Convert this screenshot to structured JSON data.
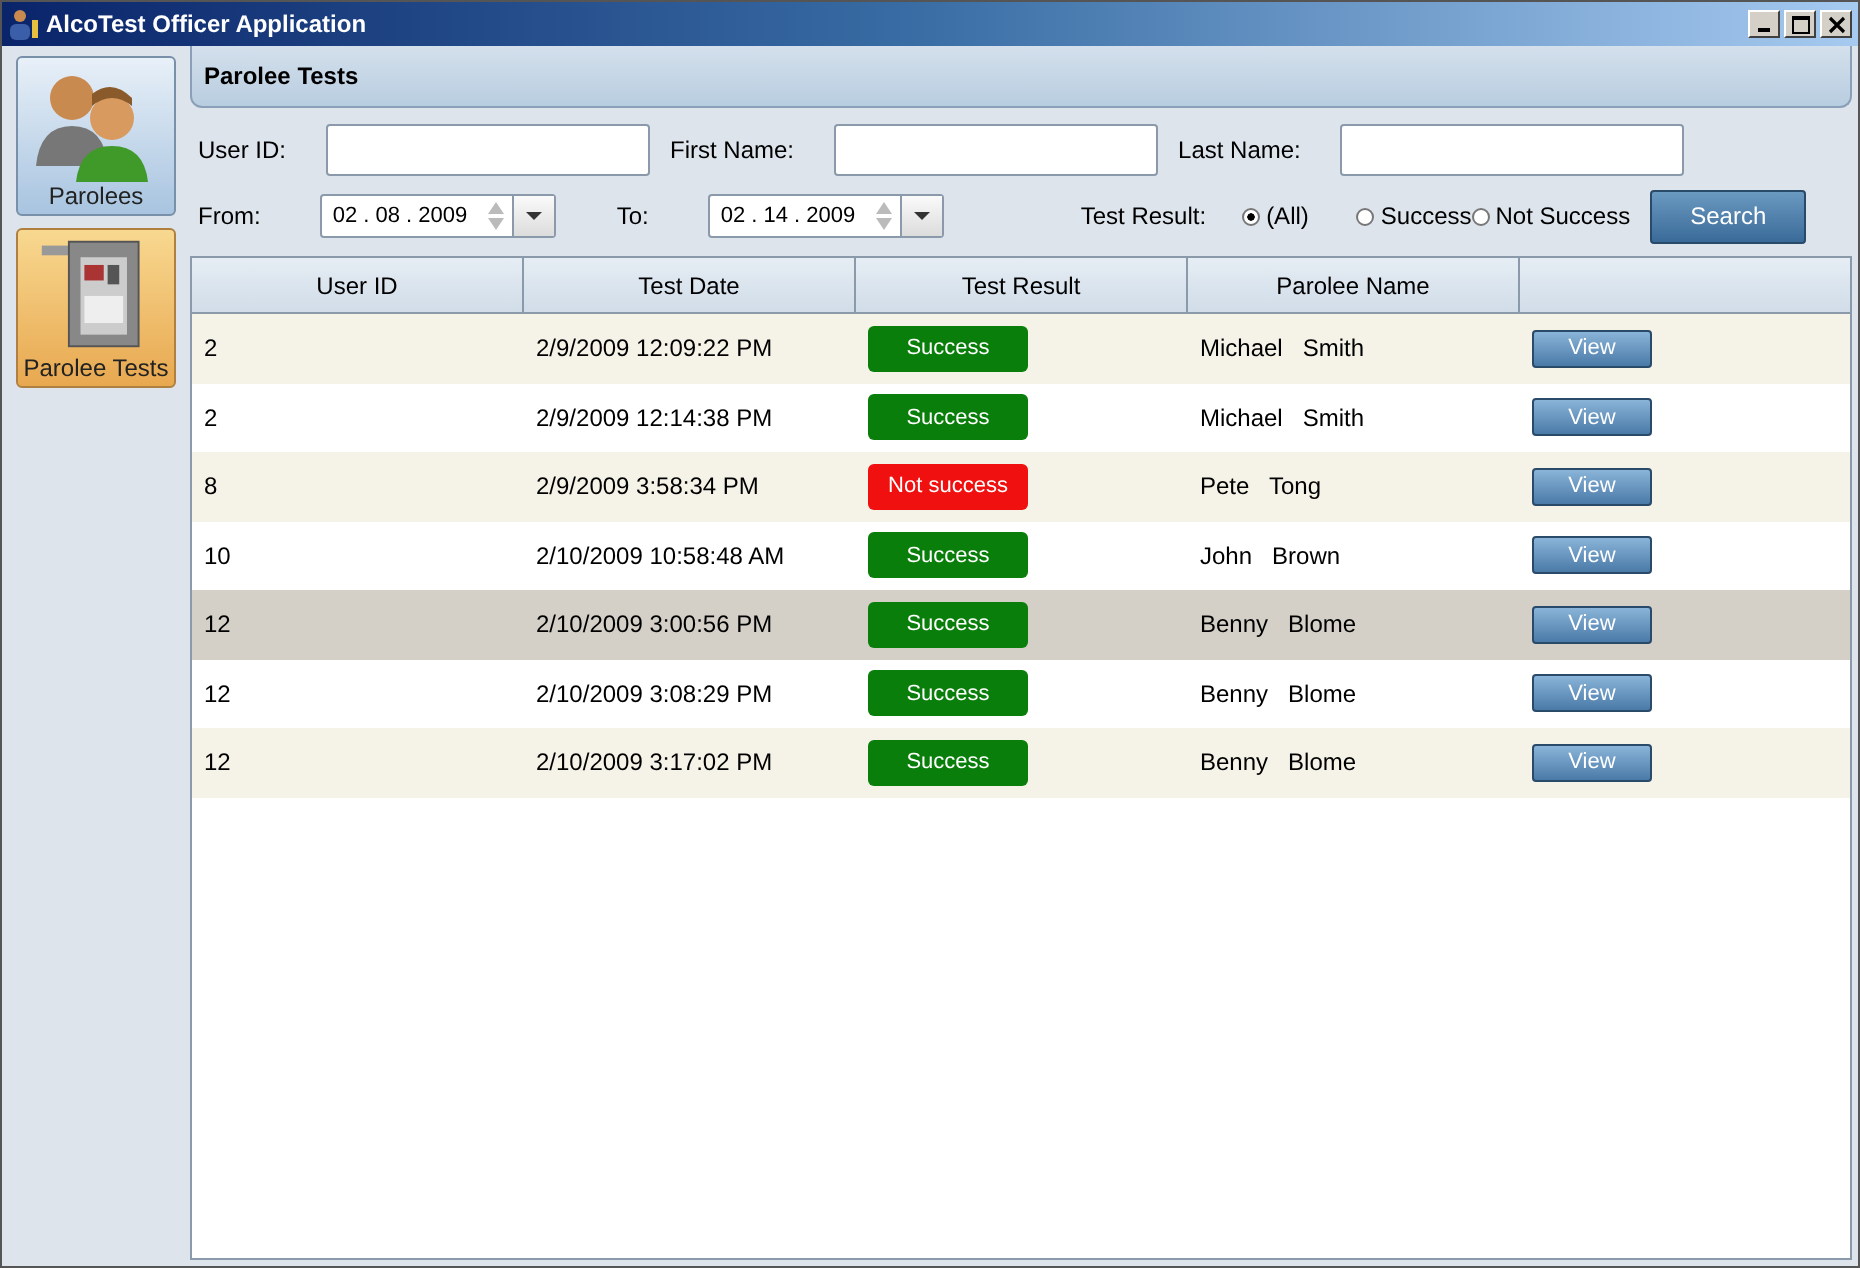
{
  "window": {
    "title": "AlcoTest Officer Application"
  },
  "sidebar": {
    "items": [
      {
        "label": "Parolees",
        "kind": "people",
        "selected": false
      },
      {
        "label": "Parolee Tests",
        "kind": "device",
        "selected": true
      }
    ]
  },
  "header": {
    "title": "Parolee Tests"
  },
  "filters": {
    "user_id": {
      "label": "User ID:"
    },
    "first_name": {
      "label": "First Name:"
    },
    "last_name": {
      "label": "Last Name:"
    },
    "from": {
      "label": "From:",
      "value": "02 . 08 . 2009"
    },
    "to": {
      "label": "To:",
      "value": "02 . 14 . 2009"
    },
    "test_result": {
      "label": "Test Result:",
      "options": [
        {
          "label": "(All)",
          "selected": true
        },
        {
          "label": "Success",
          "selected": false
        },
        {
          "label": "Not Success",
          "selected": false
        }
      ]
    },
    "search_button": "Search"
  },
  "table": {
    "columns": [
      "User ID",
      "Test Date",
      "Test Result",
      "Parolee Name"
    ],
    "rows": [
      {
        "user_id": "2",
        "test_date": "2/9/2009 12:09:22 PM",
        "result": {
          "label": "Success",
          "kind": "success"
        },
        "name": "Michael   Smith",
        "action": "View",
        "selected": false
      },
      {
        "user_id": "2",
        "test_date": "2/9/2009 12:14:38 PM",
        "result": {
          "label": "Success",
          "kind": "success"
        },
        "name": "Michael   Smith",
        "action": "View",
        "selected": false
      },
      {
        "user_id": "8",
        "test_date": "2/9/2009 3:58:34 PM",
        "result": {
          "label": "Not success",
          "kind": "fail"
        },
        "name": "Pete   Tong",
        "action": "View",
        "selected": false
      },
      {
        "user_id": "10",
        "test_date": "2/10/2009 10:58:48 AM",
        "result": {
          "label": "Success",
          "kind": "success"
        },
        "name": "John   Brown",
        "action": "View",
        "selected": false
      },
      {
        "user_id": "12",
        "test_date": "2/10/2009 3:00:56 PM",
        "result": {
          "label": "Success",
          "kind": "success"
        },
        "name": "Benny   Blome",
        "action": "View",
        "selected": true
      },
      {
        "user_id": "12",
        "test_date": "2/10/2009 3:08:29 PM",
        "result": {
          "label": "Success",
          "kind": "success"
        },
        "name": "Benny   Blome",
        "action": "View",
        "selected": false
      },
      {
        "user_id": "12",
        "test_date": "2/10/2009 3:17:02 PM",
        "result": {
          "label": "Success",
          "kind": "success"
        },
        "name": "Benny   Blome",
        "action": "View",
        "selected": false
      }
    ]
  }
}
